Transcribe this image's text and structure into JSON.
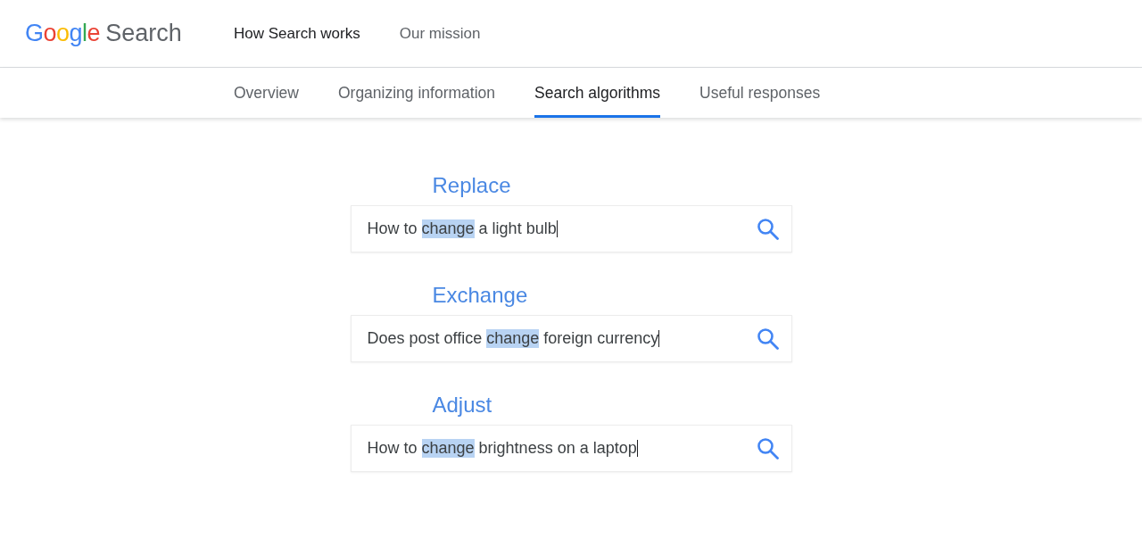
{
  "header": {
    "logo": {
      "letters": [
        {
          "text": "G",
          "color": "#4285f4"
        },
        {
          "text": "o",
          "color": "#ea4335"
        },
        {
          "text": "o",
          "color": "#fbbc05"
        },
        {
          "text": "g",
          "color": "#4285f4"
        },
        {
          "text": "l",
          "color": "#34a853"
        },
        {
          "text": "e",
          "color": "#ea4335"
        }
      ],
      "product": "Search"
    },
    "nav": [
      {
        "label": "How Search works",
        "selected": true
      },
      {
        "label": "Our mission",
        "selected": false
      }
    ]
  },
  "tabs": [
    {
      "label": "Overview",
      "selected": false
    },
    {
      "label": "Organizing information",
      "selected": false
    },
    {
      "label": "Search algorithms",
      "selected": true
    },
    {
      "label": "Useful responses",
      "selected": false
    }
  ],
  "examples": [
    {
      "title": "Replace",
      "query": [
        {
          "text": "How to ",
          "highlighted": false
        },
        {
          "text": "change",
          "highlighted": true
        },
        {
          "text": " a light bulb",
          "highlighted": false
        }
      ],
      "cursor": true
    },
    {
      "title": "Exchange",
      "query": [
        {
          "text": "Does post office ",
          "highlighted": false
        },
        {
          "text": "change",
          "highlighted": true
        },
        {
          "text": " foreign currency",
          "highlighted": false
        }
      ],
      "cursor": true
    },
    {
      "title": "Adjust",
      "query": [
        {
          "text": "How to ",
          "highlighted": false
        },
        {
          "text": "change",
          "highlighted": true
        },
        {
          "text": " brightness on a laptop",
          "highlighted": false
        }
      ],
      "cursor": true
    }
  ]
}
